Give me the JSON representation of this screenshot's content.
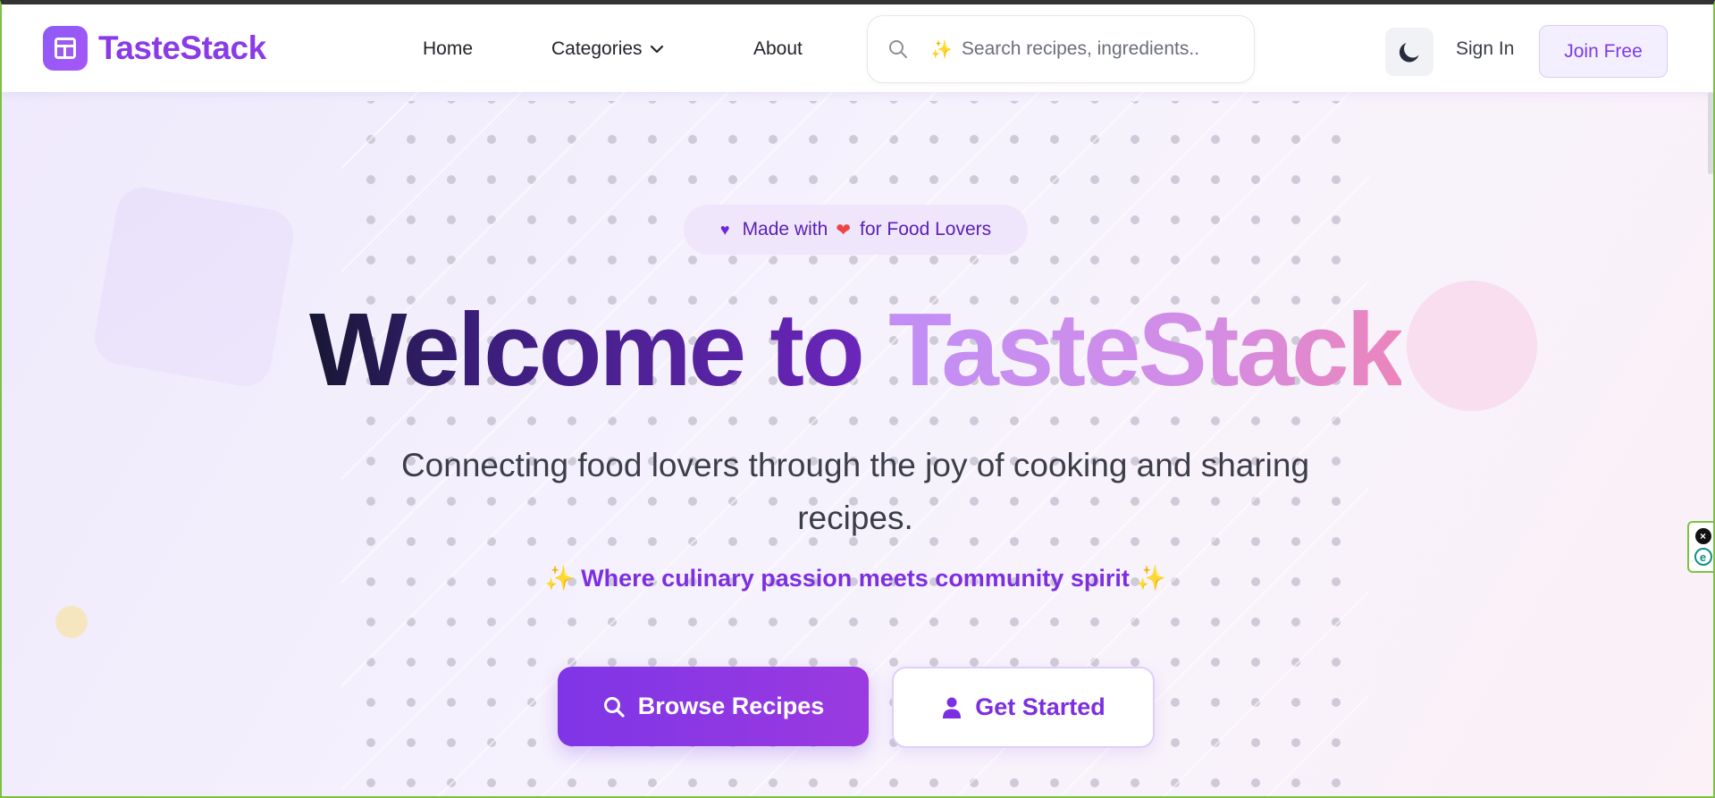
{
  "brand": {
    "name": "TasteStack",
    "color": "#8a3be6",
    "icon": "layout-icon"
  },
  "nav": {
    "home": "Home",
    "categories": "Categories",
    "about": "About"
  },
  "search": {
    "placeholder": "Search recipes, ingredients...",
    "sparkle": "✨"
  },
  "header_actions": {
    "theme_icon": "moon-icon",
    "sign_in": "Sign In",
    "join": "Join Free"
  },
  "hero": {
    "badge": {
      "prefix": "Made with",
      "suffix": "for Food Lovers",
      "heart": "❤",
      "lead_icon": "heart-icon"
    },
    "headline_part1": "Welcome to",
    "headline_part2": "TasteStack",
    "subtitle": "Connecting food lovers through the joy of cooking and sharing recipes.",
    "tagline": "Where culinary passion meets community spirit",
    "tagline_sparkle": "✨",
    "browse_button": "Browse Recipes",
    "start_button": "Get Started"
  },
  "colors": {
    "accent": "#7c3aed",
    "accent_light": "#f4effe",
    "heart_red": "#ef4444",
    "sparkle": "#f5a623"
  }
}
